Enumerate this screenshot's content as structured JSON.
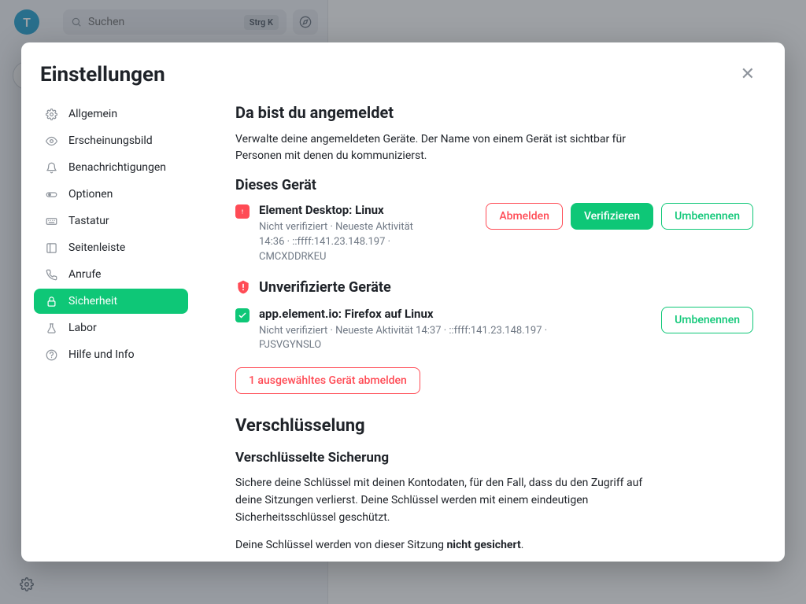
{
  "rail": {
    "avatar_initial": "T"
  },
  "header": {
    "search_placeholder": "Suchen",
    "shortcut": "Strg K"
  },
  "modal": {
    "title": "Einstellungen"
  },
  "sidebar": {
    "items": [
      {
        "icon": "gear",
        "label": "Allgemein"
      },
      {
        "icon": "eye",
        "label": "Erscheinungsbild"
      },
      {
        "icon": "bell",
        "label": "Benachrichtigungen"
      },
      {
        "icon": "toggle",
        "label": "Optionen"
      },
      {
        "icon": "keyboard",
        "label": "Tastatur"
      },
      {
        "icon": "columns",
        "label": "Seitenleiste"
      },
      {
        "icon": "phone",
        "label": "Anrufe"
      },
      {
        "icon": "lock",
        "label": "Sicherheit"
      },
      {
        "icon": "flask",
        "label": "Labor"
      },
      {
        "icon": "help",
        "label": "Hilfe und Info"
      }
    ],
    "active_index": 7
  },
  "content": {
    "sessions_title": "Da bist du angemeldet",
    "sessions_desc": "Verwalte deine angemeldeten Geräte. Der Name von einem Gerät ist sichtbar für Personen mit denen du kommunizierst.",
    "this_device_title": "Dieses Gerät",
    "this_device": {
      "name": "Element Desktop: Linux",
      "meta": "Nicht verifiziert · Neueste Aktivität 14:36 · ::ffff:141.23.148.197 · CMCXDDRKEU",
      "status": "warn",
      "actions": {
        "sign_out": "Abmelden",
        "verify": "Verifizieren",
        "rename": "Umbenennen"
      }
    },
    "unverified_title": "Unverifizierte Geräte",
    "other_device": {
      "name": "app.element.io: Firefox auf Linux",
      "meta": "Nicht verifiziert · Neueste Aktivität 14:37 · ::ffff:141.23.148.197 · PJSVGYNSLO",
      "checked": true,
      "actions": {
        "rename": "Umbenennen"
      }
    },
    "bulk_sign_out": "1 ausgewähltes Gerät abmelden",
    "encryption_title": "Verschlüsselung",
    "secure_backup_title": "Verschlüsselte Sicherung",
    "secure_backup_desc": "Sichere deine Schlüssel mit deinen Kontodaten, für den Fall, dass du den Zugriff auf deine Sitzungen verlierst. Deine Schlüssel werden mit einem eindeutigen Sicherheitsschlüssel geschützt.",
    "backup_status_prefix": "Deine Schlüssel werden von dieser Sitzung ",
    "backup_status_strong": "nicht gesichert",
    "backup_status_suffix": "."
  }
}
